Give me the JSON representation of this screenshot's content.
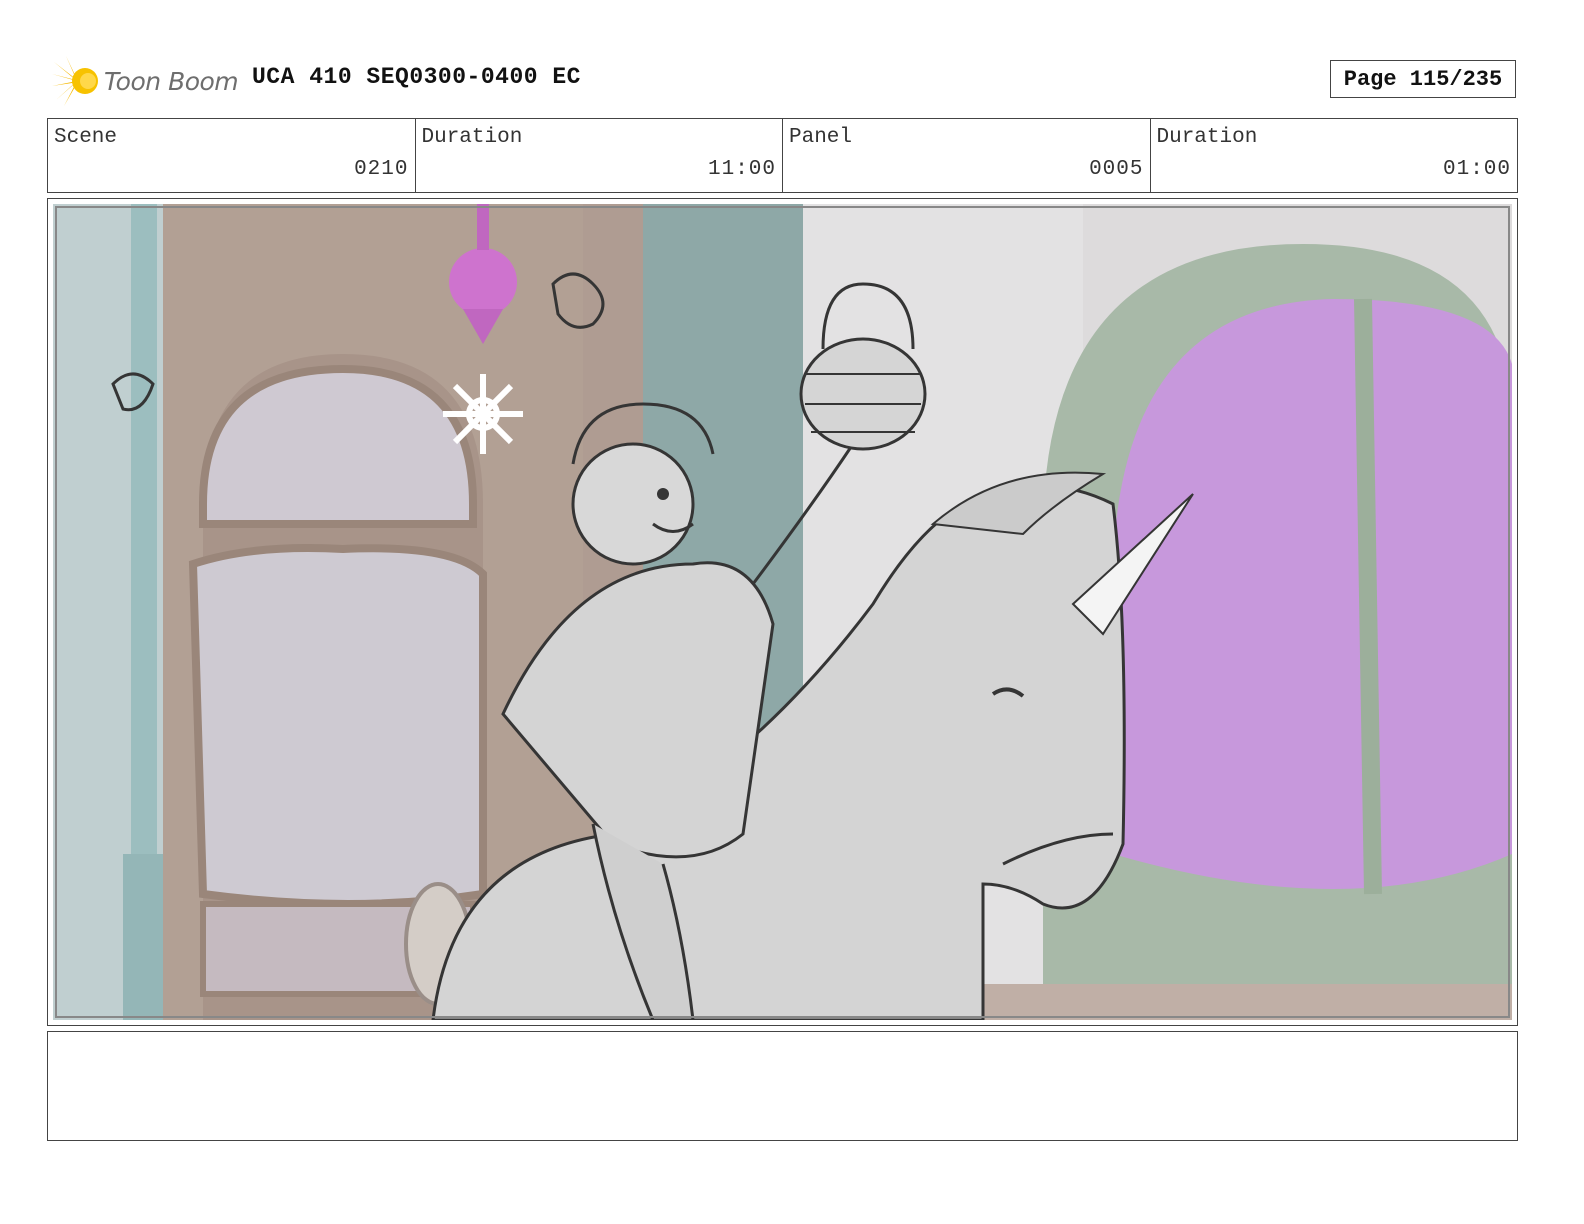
{
  "header": {
    "logo_text": "Toon Boom",
    "title": "UCA 410 SEQ0300-0400 EC",
    "page": "Page 115/235"
  },
  "info": [
    {
      "label": "Scene",
      "value": "0210"
    },
    {
      "label": "Duration",
      "value": "11:00"
    },
    {
      "label": "Panel",
      "value": "0005"
    },
    {
      "label": "Duration",
      "value": "01:00"
    }
  ],
  "colors": {
    "logo_star": "#f5b800",
    "wall_brown": "#a89386",
    "door_purple": "#c08ad8",
    "arch_green": "#9db09c",
    "pillar_teal": "#8fb5b7",
    "lamp_magenta": "#c860c8",
    "sketch_gray": "#cfcfcf"
  },
  "panel": {
    "icon": "storyboard-sketch-image"
  },
  "notes": {
    "text": ""
  }
}
